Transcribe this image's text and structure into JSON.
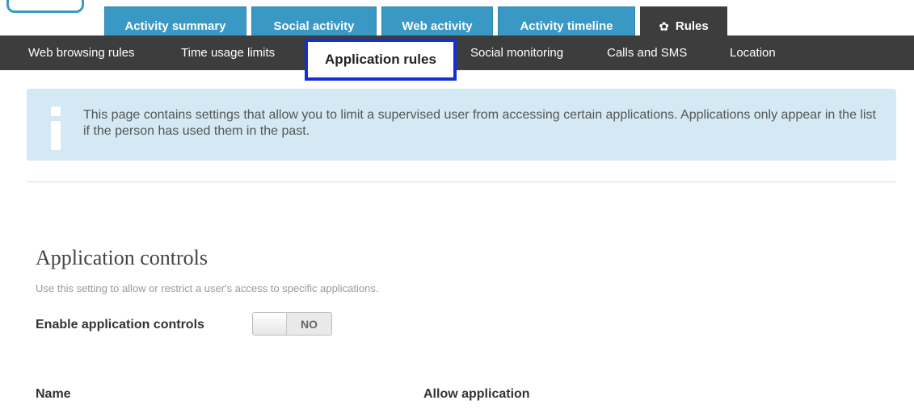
{
  "tabs": [
    {
      "label": "Activity summary"
    },
    {
      "label": "Social activity"
    },
    {
      "label": "Web activity"
    },
    {
      "label": "Activity timeline"
    },
    {
      "label": "Rules",
      "icon": "gear-icon",
      "active": true
    }
  ],
  "subnav": [
    {
      "label": "Web browsing rules"
    },
    {
      "label": "Time usage limits"
    },
    {
      "label": "Application rules",
      "selected": true
    },
    {
      "label": "Social monitoring"
    },
    {
      "label": "Calls and SMS"
    },
    {
      "label": "Location"
    }
  ],
  "info": {
    "icon": "info-icon",
    "text": "This page contains settings that allow you to limit a supervised user from accessing certain applications. Applications only appear in the list if the person has used them in the past."
  },
  "section": {
    "title": "Application controls",
    "description": "Use this setting to allow or restrict a user's access to specific applications.",
    "enable_label": "Enable application controls",
    "toggle_value": "NO"
  },
  "table": {
    "columns": [
      "Name",
      "Allow application"
    ]
  },
  "colors": {
    "tab_blue": "#3a98c4",
    "nav_dark": "#3d3d3d",
    "highlight_border": "#1230d6",
    "info_bg": "#d4e9f3"
  }
}
